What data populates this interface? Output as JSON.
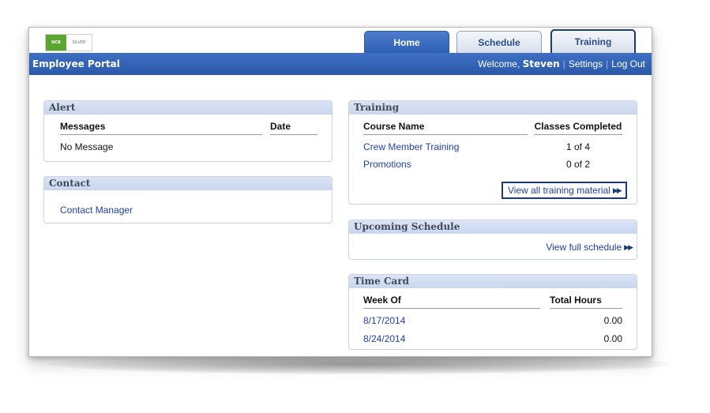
{
  "logo": {
    "brand": "NCR",
    "tier": "SILVER"
  },
  "tabs": {
    "home": "Home",
    "schedule": "Schedule",
    "training": "Training"
  },
  "navbar": {
    "title": "Employee Portal",
    "welcome": "Welcome,",
    "user": "Steven",
    "separator": "|",
    "settings": "Settings",
    "logout": "Log Out"
  },
  "alert": {
    "title": "Alert",
    "col_messages": "Messages",
    "col_date": "Date",
    "empty": "No Message"
  },
  "contact": {
    "title": "Contact",
    "link": "Contact Manager"
  },
  "training": {
    "title": "Training",
    "col_course": "Course Name",
    "col_classes": "Classes Completed",
    "rows": [
      {
        "name": "Crew Member Training",
        "completed": "1 of 4"
      },
      {
        "name": "Promotions",
        "completed": "0 of 2"
      }
    ],
    "view_all": "View all training material"
  },
  "upcoming": {
    "title": "Upcoming Schedule",
    "view_full": "View full schedule"
  },
  "timecard": {
    "title": "Time Card",
    "col_week": "Week Of",
    "col_hours": "Total Hours",
    "rows": [
      {
        "week": "8/17/2014",
        "hours": "0.00"
      },
      {
        "week": "8/24/2014",
        "hours": "0.00"
      }
    ]
  },
  "icons": {
    "forward": "fast-forward-icon"
  }
}
